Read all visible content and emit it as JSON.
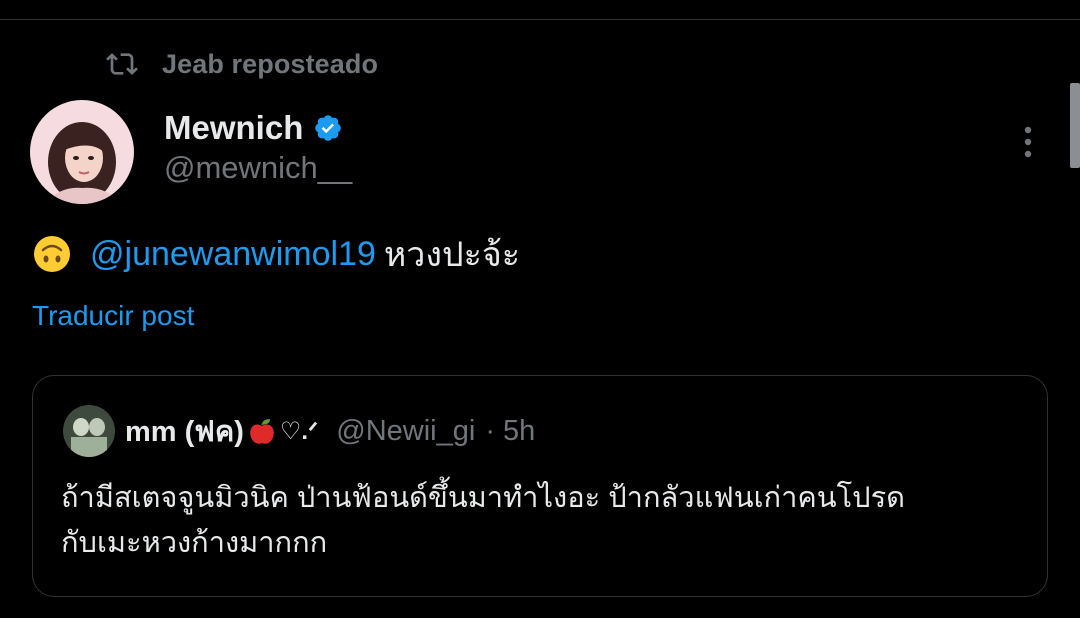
{
  "repost": {
    "label": "Jeab reposteado",
    "icon": "repost-icon"
  },
  "author": {
    "display_name": "Mewnich",
    "handle": "@mewnich__",
    "verified": true,
    "verified_color": "#1d9bf0"
  },
  "tweet": {
    "emoji": "upside-down-face-emoji",
    "mention": "@junewanwimol19",
    "text": "หวงปะจ้ะ",
    "translate_label": "Traducir post"
  },
  "quote": {
    "display_name": "mm (ฟค)",
    "name_suffix": "♡.ᐟ",
    "apple_icon": "apple-emoji",
    "handle": "@Newii_gi",
    "separator": "·",
    "time": "5h",
    "body_lines": [
      "ถ้ามีสเตจจูนมิวนิค ป่านฟ้อนด์ขึ้นมาทำไงอะ ป้ากลัวแฟนเก่าคนโปรด",
      "กับเมะหวงก้างมากกก"
    ]
  },
  "colors": {
    "background": "#000000",
    "primary_text": "#e7e9ea",
    "secondary_text": "#71767b",
    "link": "#1d9bf0",
    "border": "#2f3336"
  }
}
